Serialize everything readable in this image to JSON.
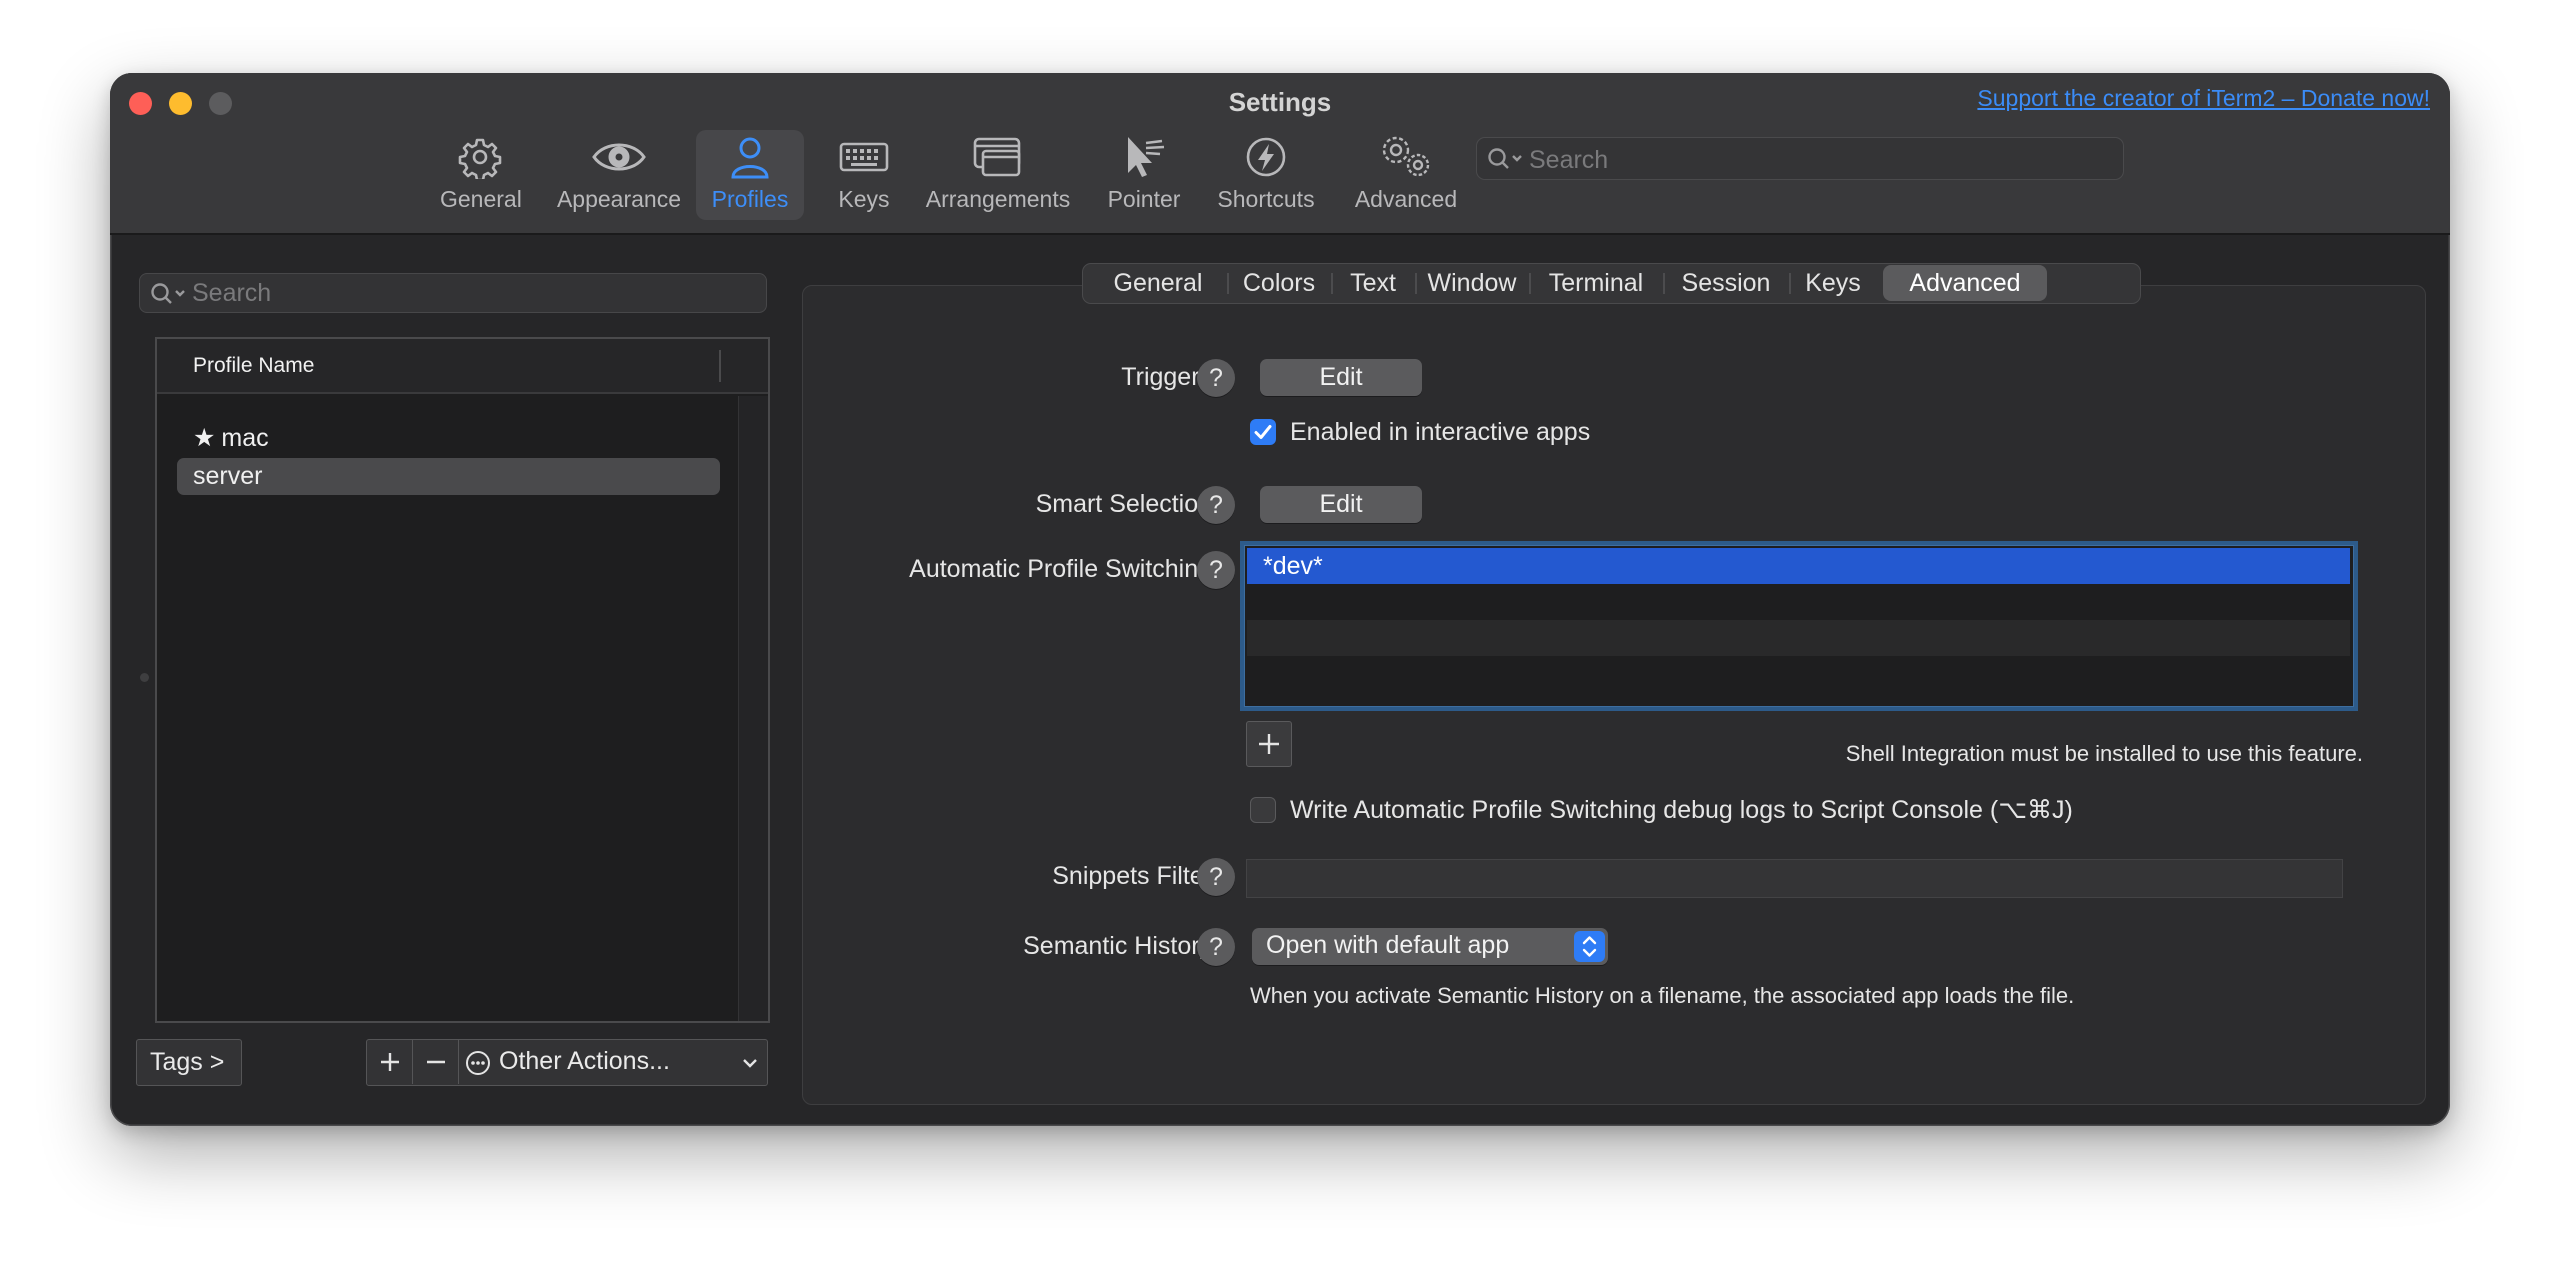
{
  "window": {
    "title": "Settings",
    "donate_link": "Support the creator of iTerm2 – Donate now!"
  },
  "toolbar": {
    "items": [
      {
        "label": "General",
        "icon": "gear-icon"
      },
      {
        "label": "Appearance",
        "icon": "eye-icon"
      },
      {
        "label": "Profiles",
        "icon": "person-icon",
        "active": true
      },
      {
        "label": "Keys",
        "icon": "keyboard-icon"
      },
      {
        "label": "Arrangements",
        "icon": "windows-icon"
      },
      {
        "label": "Pointer",
        "icon": "pointer-icon"
      },
      {
        "label": "Shortcuts",
        "icon": "bolt-icon"
      },
      {
        "label": "Advanced",
        "icon": "gears-icon"
      }
    ],
    "search_placeholder": "Search"
  },
  "profiles": {
    "search_placeholder": "Search",
    "column_header": "Profile Name",
    "items": [
      {
        "name": "mac",
        "default": true
      },
      {
        "name": "server",
        "selected": true
      }
    ],
    "tags_button": "Tags >",
    "add_button": "+",
    "remove_button": "–",
    "other_actions": "Other Actions..."
  },
  "tabs": [
    "General",
    "Colors",
    "Text",
    "Window",
    "Terminal",
    "Session",
    "Keys",
    "Advanced"
  ],
  "active_tab": "Advanced",
  "advanced": {
    "triggers_label": "Triggers:",
    "triggers_button": "Edit",
    "interactive_apps_label": "Enabled in interactive apps",
    "interactive_apps_checked": true,
    "smart_selection_label": "Smart Selection:",
    "smart_selection_button": "Edit",
    "aps_label": "Automatic Profile Switching:",
    "aps_rules": [
      "*dev*"
    ],
    "aps_add_button": "+",
    "shell_integration_note": "Shell Integration must be installed to use this feature.",
    "debug_logs_label": "Write Automatic Profile Switching debug logs to Script Console (⌥⌘J)",
    "debug_logs_checked": false,
    "snippets_filter_label": "Snippets Filter:",
    "snippets_filter_value": "",
    "semantic_history_label": "Semantic History:",
    "semantic_history_value": "Open with default app",
    "semantic_history_note": "When you activate Semantic History on a filename, the associated app loads the file.",
    "help_label": "?"
  },
  "colors": {
    "accent": "#2e7cf6",
    "selection": "#2459d0",
    "link": "#3b8cf7",
    "close": "#fe5f57",
    "minimize": "#febc2e"
  }
}
